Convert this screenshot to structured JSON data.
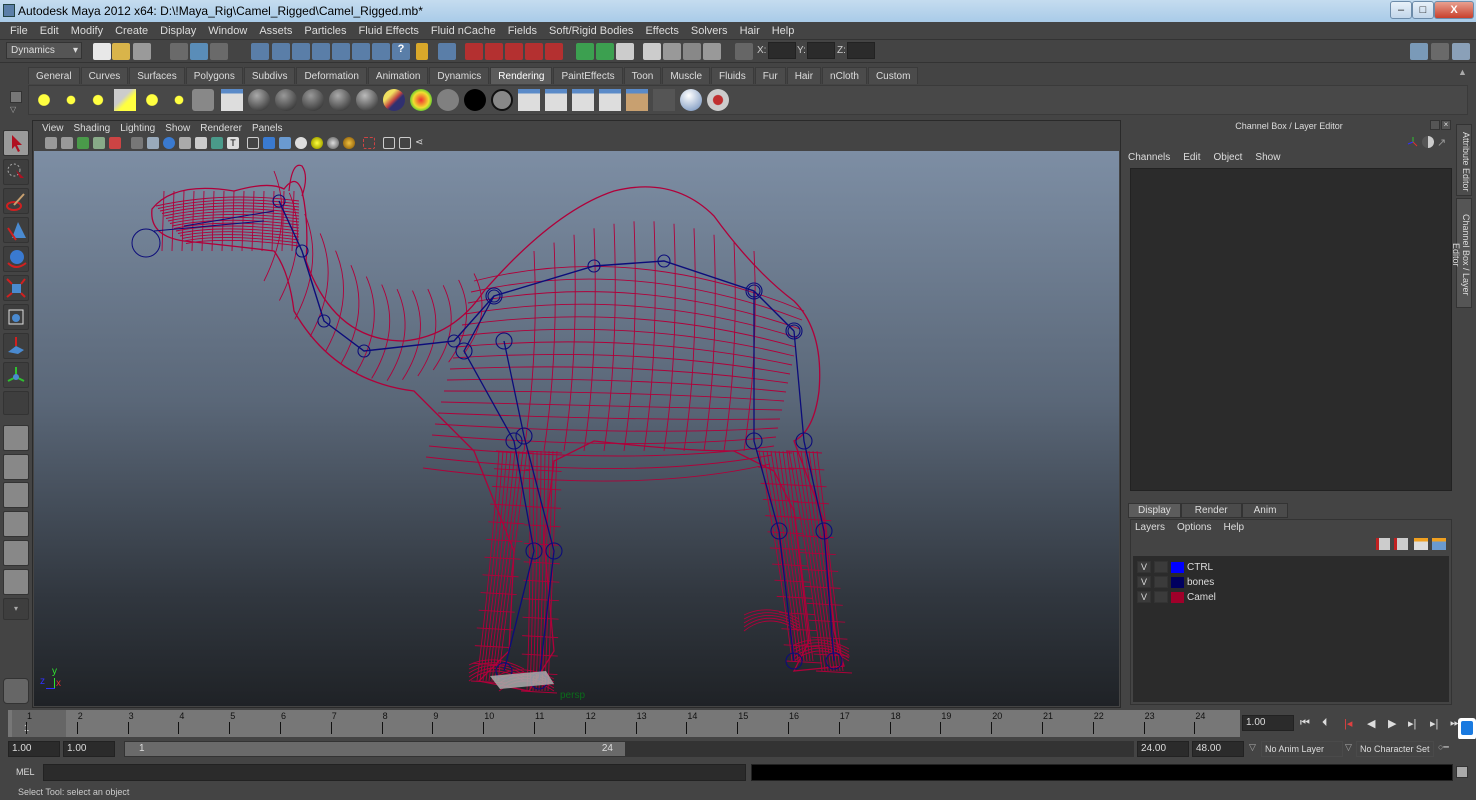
{
  "window": {
    "title": "Autodesk Maya 2012 x64: D:\\!Maya_Rig\\Camel_Rigged\\Camel_Rigged.mb*",
    "controls": {
      "minimize": "–",
      "maximize": "□",
      "close": "X"
    }
  },
  "menubar": [
    "File",
    "Edit",
    "Modify",
    "Create",
    "Display",
    "Window",
    "Assets",
    "Particles",
    "Fluid Effects",
    "Fluid nCache",
    "Fields",
    "Soft/Rigid Bodies",
    "Effects",
    "Solvers",
    "Hair",
    "Help"
  ],
  "status_line": {
    "menu_set": "Dynamics",
    "xyz_labels": {
      "x": "X:",
      "y": "Y:",
      "z": "Z:"
    },
    "icons": [
      "new-scene-icon",
      "open-scene-icon",
      "save-scene-icon",
      "select-hierarchy-icon",
      "select-object-icon",
      "select-component-icon",
      "snap-grid-icon",
      "snap-curve-icon",
      "snap-point-icon",
      "snap-view-plane-icon",
      "snap-live-icon",
      "question-icon",
      "lock-icon",
      "select-highlight-icon",
      "construction-history-icon",
      "render-view-icon",
      "render-current-icon",
      "ipr-render-icon",
      "render-settings-icon",
      "hypershade-icon"
    ]
  },
  "shelf": {
    "tabs": [
      "General",
      "Curves",
      "Surfaces",
      "Polygons",
      "Subdivs",
      "Deformation",
      "Animation",
      "Dynamics",
      "Rendering",
      "PaintEffects",
      "Toon",
      "Muscle",
      "Fluids",
      "Fur",
      "Hair",
      "nCloth",
      "Custom"
    ],
    "active_tab": "Rendering",
    "icons": [
      "ambient-light-icon",
      "directional-light-icon",
      "point-light-icon",
      "spot-light-icon",
      "area-light-icon",
      "volume-light-icon",
      "camera-icon",
      "camera-aim-icon",
      "blinn-sphere-icon",
      "lambert-sphere-icon",
      "phong-sphere-icon",
      "phonge-sphere-icon",
      "anisotropic-sphere-icon",
      "layered-shader-icon",
      "ramp-shader-icon",
      "gray-shader-icon",
      "black-shader-icon",
      "surface-shader-icon",
      "render-view-icon",
      "render-current-icon",
      "ipr-render-icon",
      "batch-render-icon",
      "hypershade-icon",
      "light-linking-icon",
      "render-settings-icon",
      "paint-brush-icon"
    ]
  },
  "toolbox": [
    "select-tool-icon",
    "lasso-tool-icon",
    "paint-select-tool-icon",
    "move-tool-icon",
    "rotate-tool-icon",
    "scale-tool-icon",
    "manipulator-tool-icon",
    "soft-mod-tool-icon",
    "last-tool-icon",
    "empty-slot",
    "single-perspective-layout-icon",
    "four-view-layout-icon",
    "outliner-perspective-layout-icon",
    "graph-persp-layout-icon",
    "hypershade-persp-layout-icon",
    "persp-graph-hypershade-layout-icon",
    "more-layouts-icon",
    "maya-logo-icon"
  ],
  "viewport": {
    "menu": [
      "View",
      "Shading",
      "Lighting",
      "Show",
      "Renderer",
      "Panels"
    ],
    "camera_label": "persp",
    "axis": {
      "x": "x",
      "y": "y",
      "z": "z"
    },
    "colors": {
      "mesh": "#b0003a",
      "bones": "#0c0c7a",
      "camera_label": "#0a6d1a"
    }
  },
  "channel_box": {
    "title": "Channel Box / Layer Editor",
    "menu": [
      "Channels",
      "Edit",
      "Object",
      "Show"
    ]
  },
  "layer_editor": {
    "tabs": [
      "Display",
      "Render",
      "Anim"
    ],
    "active_tab": "Display",
    "menu": [
      "Layers",
      "Options",
      "Help"
    ],
    "layers": [
      {
        "visible": "V",
        "name": "CTRL",
        "color": "#0000ff"
      },
      {
        "visible": "V",
        "name": "bones",
        "color": "#00005f"
      },
      {
        "visible": "V",
        "name": "Camel",
        "color": "#a0002a"
      }
    ]
  },
  "side_tabs": [
    "Attribute Editor",
    "Channel Box / Layer Editor"
  ],
  "time_slider": {
    "frames": [
      "1",
      "2",
      "3",
      "4",
      "5",
      "6",
      "7",
      "8",
      "9",
      "10",
      "11",
      "12",
      "13",
      "14",
      "15",
      "16",
      "17",
      "18",
      "19",
      "20",
      "21",
      "22",
      "23",
      "24"
    ],
    "current_frame_label": "1",
    "current_time": "1.00"
  },
  "range_slider": {
    "start_time": "1.00",
    "playback_start": "1.00",
    "range_start": "1",
    "range_end": "24",
    "playback_end": "24.00",
    "end_time": "48.00",
    "anim_layer": "No Anim Layer",
    "character_set": "No Character Set"
  },
  "command_line": {
    "label": "MEL",
    "value": "",
    "result": ""
  },
  "help_line": "Select Tool: select an object"
}
